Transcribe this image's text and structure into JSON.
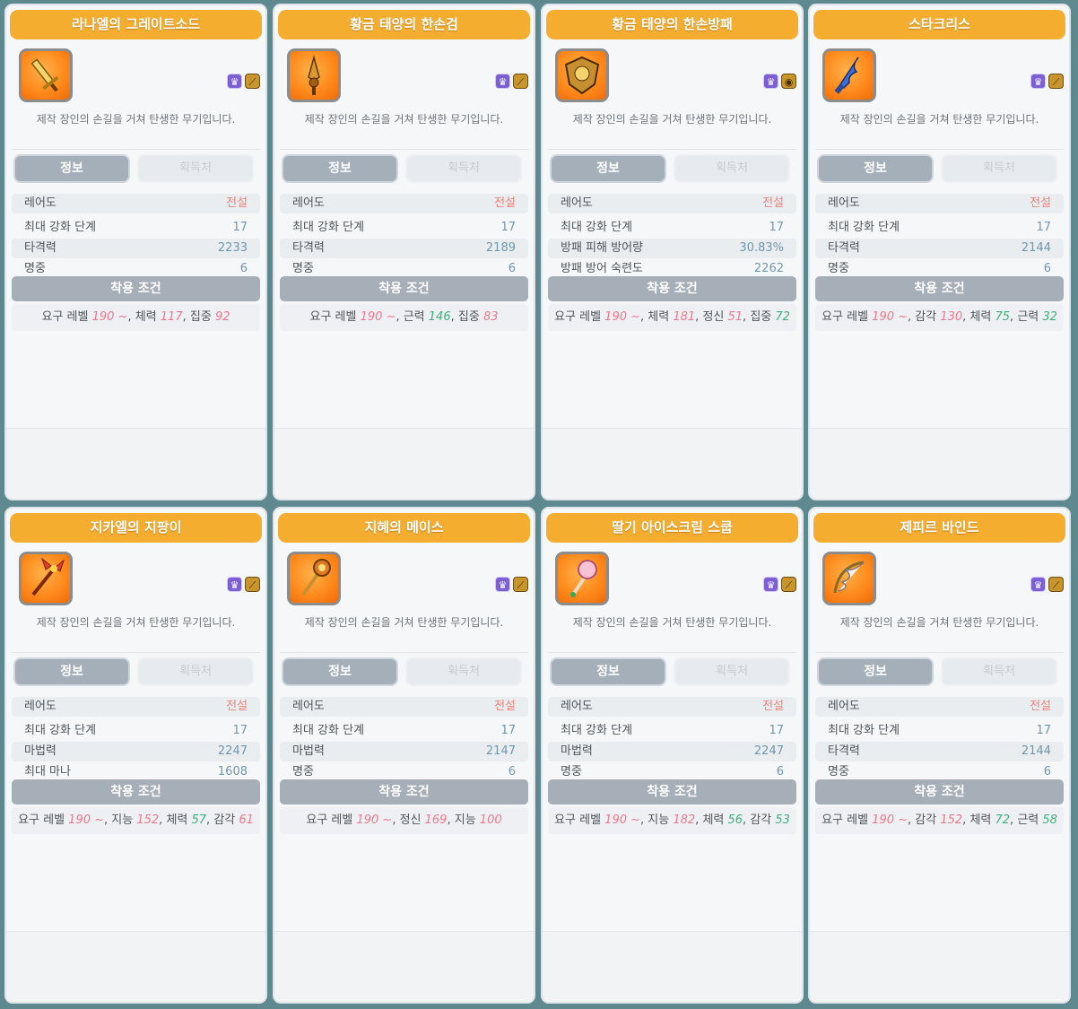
{
  "common": {
    "description": "제작 장인의 손길을 거쳐 탄생한 무기입니다.",
    "tab_info": "정보",
    "tab_source": "획득처",
    "requirements_title": "착용 조건",
    "req_level_label": "요구 레벨"
  },
  "colors": {
    "card_title": "#f4ad2f",
    "legend": "#f2827a",
    "stat_value": "#6f97ad",
    "req_red": "#f0788c",
    "req_green": "#3fb07a"
  },
  "cards": [
    {
      "title": "라나엘의 그레이트소드",
      "icon": "greatsword-icon",
      "badges": [
        "class-emblem-icon",
        "sword-type-icon"
      ],
      "rows": [
        [
          "레어도",
          "전설"
        ],
        [
          "최대 강화 단계",
          "17"
        ],
        [
          "타격력",
          "2233"
        ],
        [
          "명중",
          "6"
        ]
      ],
      "req": [
        [
          "",
          "190 ~",
          "r"
        ],
        [
          "체력",
          "117",
          "r"
        ],
        [
          "집중",
          "92",
          "r"
        ]
      ]
    },
    {
      "title": "황금 태양의 한손검",
      "icon": "one-hand-sword-icon",
      "badges": [
        "class-emblem-icon",
        "sword-type-icon"
      ],
      "rows": [
        [
          "레어도",
          "전설"
        ],
        [
          "최대 강화 단계",
          "17"
        ],
        [
          "타격력",
          "2189"
        ],
        [
          "명중",
          "6"
        ]
      ],
      "req": [
        [
          "",
          "190 ~",
          "r"
        ],
        [
          "근력",
          "146",
          "g"
        ],
        [
          "집중",
          "83",
          "r"
        ]
      ]
    },
    {
      "title": "황금 태양의 한손방패",
      "icon": "shield-icon",
      "badges": [
        "class-emblem-icon",
        "shield-type-icon"
      ],
      "rows": [
        [
          "레어도",
          "전설"
        ],
        [
          "최대 강화 단계",
          "17"
        ],
        [
          "방패 피해 방어량",
          "30.83%"
        ],
        [
          "방패 방어 숙련도",
          "2262"
        ]
      ],
      "req": [
        [
          "",
          "190 ~",
          "r"
        ],
        [
          "체력",
          "181",
          "r"
        ],
        [
          "정신",
          "51",
          "r"
        ],
        [
          "집중",
          "72",
          "g"
        ]
      ]
    },
    {
      "title": "스타크리스",
      "icon": "kris-dagger-icon",
      "badges": [
        "class-emblem-icon",
        "sword-type-icon"
      ],
      "rows": [
        [
          "레어도",
          "전설"
        ],
        [
          "최대 강화 단계",
          "17"
        ],
        [
          "타격력",
          "2144"
        ],
        [
          "명중",
          "6"
        ]
      ],
      "req": [
        [
          "",
          "190 ~",
          "r"
        ],
        [
          "감각",
          "130",
          "r"
        ],
        [
          "체력",
          "75",
          "g"
        ],
        [
          "근력",
          "32",
          "g"
        ]
      ]
    },
    {
      "title": "지카엘의 지팡이",
      "icon": "winged-staff-icon",
      "badges": [
        "class-emblem-icon",
        "staff-type-icon"
      ],
      "rows": [
        [
          "레어도",
          "전설"
        ],
        [
          "최대 강화 단계",
          "17"
        ],
        [
          "마법력",
          "2247"
        ],
        [
          "최대 마나",
          "1608"
        ]
      ],
      "req": [
        [
          "",
          "190 ~",
          "r"
        ],
        [
          "지능",
          "152",
          "r"
        ],
        [
          "체력",
          "57",
          "g"
        ],
        [
          "감각",
          "61",
          "r"
        ]
      ]
    },
    {
      "title": "지혜의 메이스",
      "icon": "mace-icon",
      "badges": [
        "class-emblem-icon",
        "staff-type-icon"
      ],
      "rows": [
        [
          "레어도",
          "전설"
        ],
        [
          "최대 강화 단계",
          "17"
        ],
        [
          "마법력",
          "2147"
        ],
        [
          "명중",
          "6"
        ]
      ],
      "req": [
        [
          "",
          "190 ~",
          "r"
        ],
        [
          "정신",
          "169",
          "r"
        ],
        [
          "지능",
          "100",
          "r"
        ]
      ]
    },
    {
      "title": "딸기 아이스크림 스쿱",
      "icon": "ice-cream-scoop-icon",
      "badges": [
        "class-emblem-icon",
        "staff-type-icon"
      ],
      "rows": [
        [
          "레어도",
          "전설"
        ],
        [
          "최대 강화 단계",
          "17"
        ],
        [
          "마법력",
          "2247"
        ],
        [
          "명중",
          "6"
        ]
      ],
      "req": [
        [
          "",
          "190 ~",
          "r"
        ],
        [
          "지능",
          "182",
          "r"
        ],
        [
          "체력",
          "56",
          "g"
        ],
        [
          "감각",
          "53",
          "g"
        ]
      ]
    },
    {
      "title": "제피르 바인드",
      "icon": "winged-bow-icon",
      "badges": [
        "class-emblem-icon",
        "bow-type-icon"
      ],
      "rows": [
        [
          "레어도",
          "전설"
        ],
        [
          "최대 강화 단계",
          "17"
        ],
        [
          "타격력",
          "2144"
        ],
        [
          "명중",
          "6"
        ]
      ],
      "req": [
        [
          "",
          "190 ~",
          "r"
        ],
        [
          "감각",
          "152",
          "r"
        ],
        [
          "체력",
          "72",
          "g"
        ],
        [
          "근력",
          "58",
          "g"
        ]
      ]
    }
  ]
}
